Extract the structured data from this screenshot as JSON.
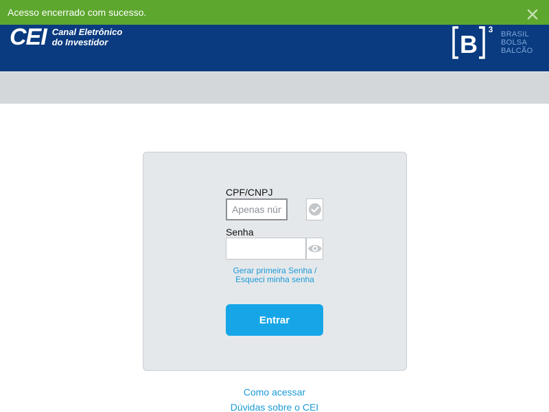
{
  "notification": {
    "message": "Acesso encerrado com sucesso.",
    "close_icon": "close-icon",
    "color": "#5ea72f"
  },
  "header": {
    "logo_mark": "CEI",
    "logo_line1": "Canal Eletrônico",
    "logo_line2": "do Investidor",
    "b3_line1": "BRASIL",
    "b3_line2": "BOLSA",
    "b3_line3": "BALCÃO",
    "background_color": "#0a3b80"
  },
  "login": {
    "cpf_label": "CPF/CNPJ",
    "cpf_placeholder": "Apenas números",
    "cpf_value": "",
    "senha_label": "Senha",
    "senha_value": "",
    "forgot_line1": "Gerar primeira Senha /",
    "forgot_line2": "Esqueci minha senha",
    "submit_label": "Entrar",
    "button_color": "#16a6e8",
    "cpf_addon_icon": "checkmark-circle-icon",
    "senha_addon_icon": "eye-icon"
  },
  "footer": {
    "link1": "Como acessar",
    "link2": "Dúvidas sobre o CEI"
  }
}
